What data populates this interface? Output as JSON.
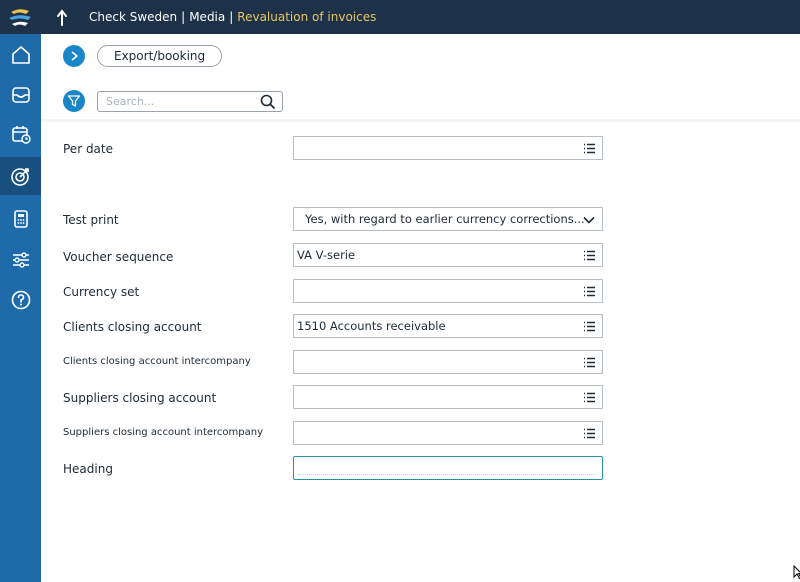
{
  "header": {
    "company": "Check Sweden",
    "module": "Media",
    "page": "Revaluation of invoices",
    "separator": "|"
  },
  "sidebar": {
    "items": [
      {
        "icon": "home-icon"
      },
      {
        "icon": "inbox-icon"
      },
      {
        "icon": "calendar-clock-icon"
      },
      {
        "icon": "target-icon",
        "active": true
      },
      {
        "icon": "calculator-icon"
      },
      {
        "icon": "sliders-icon"
      },
      {
        "icon": "help-icon"
      }
    ]
  },
  "toolbar": {
    "export_label": "Export/booking",
    "search_placeholder": "Search..."
  },
  "form": {
    "per_date": {
      "label": "Per date",
      "value": ""
    },
    "test_print": {
      "label": "Test print",
      "value": "Yes, with regard to earlier currency corrections..."
    },
    "voucher_sequence": {
      "label": "Voucher sequence",
      "value": "VA V-serie"
    },
    "currency_set": {
      "label": "Currency set",
      "value": ""
    },
    "clients_closing_account": {
      "label": "Clients closing account",
      "value": "1510 Accounts receivable"
    },
    "clients_closing_account_ic": {
      "label": "Clients closing account intercompany",
      "value": ""
    },
    "suppliers_closing_account": {
      "label": "Suppliers closing account",
      "value": ""
    },
    "suppliers_closing_account_ic": {
      "label": "Suppliers closing account intercompany",
      "value": ""
    },
    "heading": {
      "label": "Heading",
      "value": ""
    }
  },
  "colors": {
    "titlebar": "#1d3248",
    "sidebar": "#1f6aa9",
    "sidebar_active": "#174f7e",
    "accent": "#1a86c7",
    "breadcrumb_current": "#e6c463"
  }
}
